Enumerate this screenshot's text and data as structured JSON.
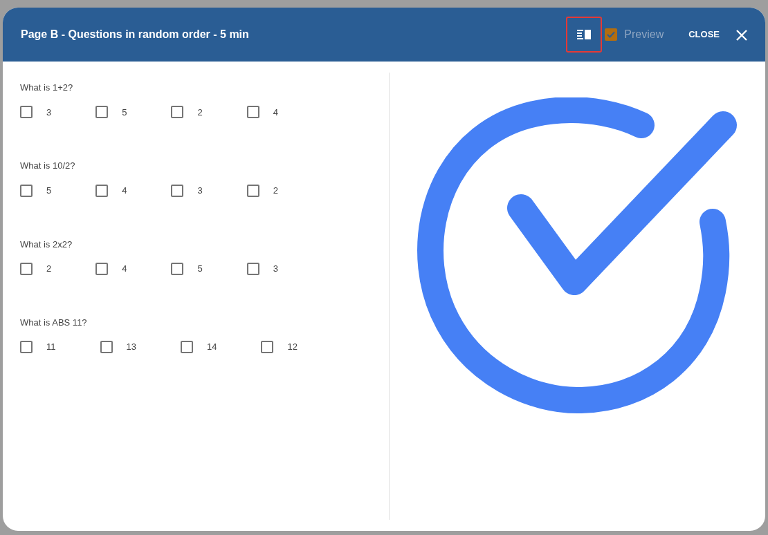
{
  "dialog": {
    "title": "Page B - Questions in random order - 5 min",
    "layout_button": {
      "highlighted": true
    },
    "preview": {
      "label": "Preview",
      "checked": true
    },
    "close_label": "CLOSE"
  },
  "questions": [
    {
      "text": "What is 1+2?",
      "options": [
        {
          "label": "3",
          "checked": false
        },
        {
          "label": "5",
          "checked": false
        },
        {
          "label": "2",
          "checked": false
        },
        {
          "label": "4",
          "checked": false
        }
      ]
    },
    {
      "text": "What is 10/2?",
      "options": [
        {
          "label": "5",
          "checked": false
        },
        {
          "label": "4",
          "checked": false
        },
        {
          "label": "3",
          "checked": false
        },
        {
          "label": "2",
          "checked": false
        }
      ]
    },
    {
      "text": "What is 2x2?",
      "options": [
        {
          "label": "2",
          "checked": false
        },
        {
          "label": "4",
          "checked": false
        },
        {
          "label": "5",
          "checked": false
        },
        {
          "label": "3",
          "checked": false
        }
      ]
    },
    {
      "text": "What is ABS 11?",
      "options": [
        {
          "label": "11",
          "checked": false
        },
        {
          "label": "13",
          "checked": false
        },
        {
          "label": "14",
          "checked": false
        },
        {
          "label": "12",
          "checked": false
        }
      ]
    }
  ]
}
